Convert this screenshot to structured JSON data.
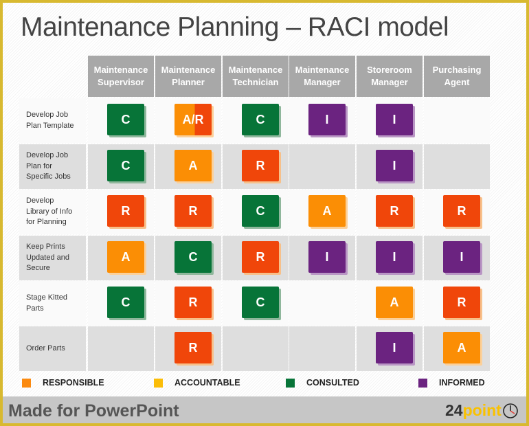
{
  "title": "Maintenance Planning – RACI model",
  "columns": [
    {
      "line1": "Maintenance",
      "line2": "Supervisor"
    },
    {
      "line1": "Maintenance",
      "line2": "Planner"
    },
    {
      "line1": "Maintenance",
      "line2": "Technician"
    },
    {
      "line1": "Maintenance",
      "line2": "Manager"
    },
    {
      "line1": "Storeroom",
      "line2": "Manager"
    },
    {
      "line1": "Purchasing",
      "line2": "Agent"
    }
  ],
  "rows": [
    {
      "label": [
        "Develop Job",
        "Plan Template"
      ],
      "cells": [
        "C",
        "A/R",
        "C",
        "I",
        "I",
        ""
      ]
    },
    {
      "label": [
        "Develop Job",
        "Plan for",
        "Specific Jobs"
      ],
      "cells": [
        "C",
        "A",
        "R",
        "",
        "I",
        ""
      ]
    },
    {
      "label": [
        "Develop",
        "Library of Info",
        "for Planning"
      ],
      "cells": [
        "R",
        "R",
        "C",
        "A",
        "R",
        "R"
      ]
    },
    {
      "label": [
        "Keep Prints",
        "Updated and",
        "Secure"
      ],
      "cells": [
        "A",
        "C",
        "R",
        "I",
        "I",
        "I"
      ]
    },
    {
      "label": [
        "Stage  Kitted",
        "Parts"
      ],
      "cells": [
        "C",
        "R",
        "C",
        "",
        "A",
        "R"
      ]
    },
    {
      "label": [
        "Order Parts"
      ],
      "cells": [
        "",
        "R",
        "",
        "",
        "I",
        "A"
      ]
    }
  ],
  "legend": [
    {
      "label": "RESPONSIBLE",
      "color": "#fb8a10"
    },
    {
      "label": "ACCOUNTABLE",
      "color": "#fbbd08"
    },
    {
      "label": "CONSULTED",
      "color": "#077438"
    },
    {
      "label": "INFORMED",
      "color": "#6b2380"
    }
  ],
  "colors": {
    "R": "#f0460a",
    "A": "#fb8e05",
    "C": "#077438",
    "I": "#6b2380",
    "header": "#a8a8a8"
  },
  "footer": {
    "text": "Made for PowerPoint",
    "brand_number": "24",
    "brand_word": "point",
    "brand_icon": "clock-icon"
  }
}
